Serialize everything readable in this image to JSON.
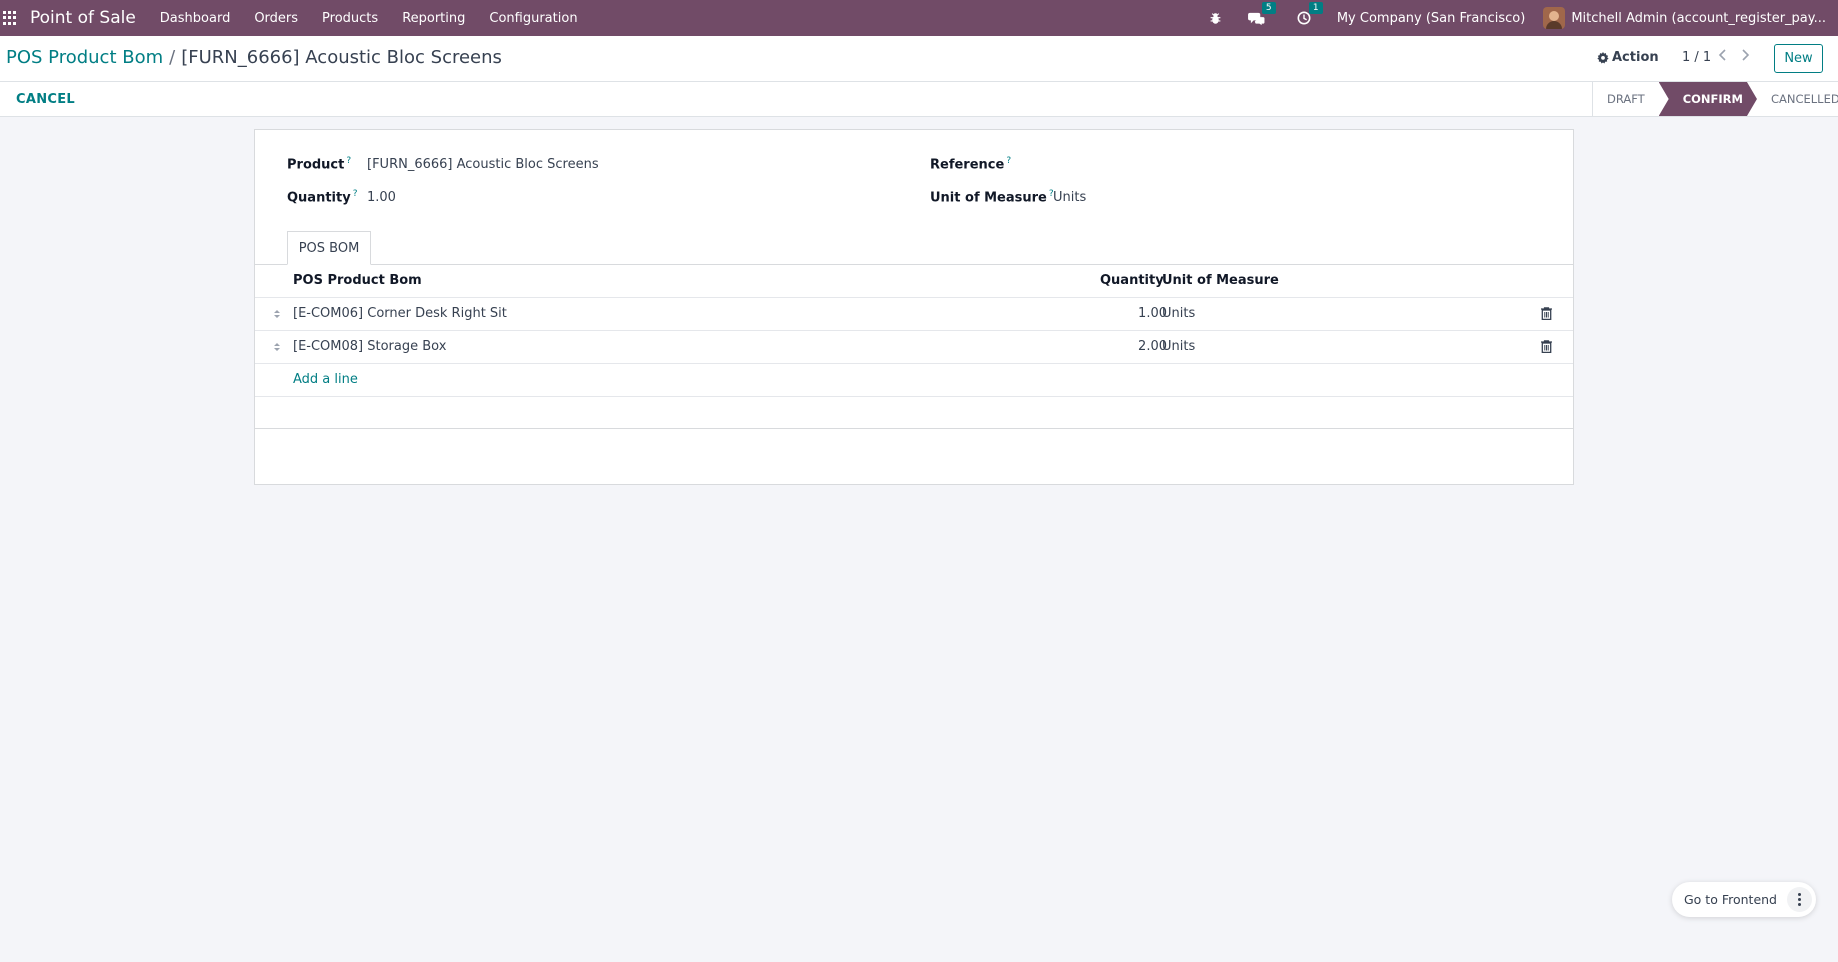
{
  "navbar": {
    "app_title": "Point of Sale",
    "menu": [
      "Dashboard",
      "Orders",
      "Products",
      "Reporting",
      "Configuration"
    ],
    "messages_count": "5",
    "activities_count": "1",
    "company": "My Company (San Francisco)",
    "user": "Mitchell Admin (account_register_pay..."
  },
  "breadcrumb": {
    "parent": "POS Product Bom",
    "separator": "/",
    "current": "[FURN_6666] Acoustic Bloc Screens"
  },
  "controls": {
    "action_label": "Action",
    "pager": "1 / 1",
    "new_label": "New"
  },
  "statusbar": {
    "cancel_label": "CANCEL",
    "states": [
      "DRAFT",
      "CONFIRM",
      "CANCELLED"
    ],
    "active_state": "CONFIRM"
  },
  "form": {
    "product_label": "Product",
    "product_value": "[FURN_6666] Acoustic Bloc Screens",
    "quantity_label": "Quantity",
    "quantity_value": "1.00",
    "reference_label": "Reference",
    "reference_value": "",
    "uom_label": "Unit of Measure",
    "uom_value": "Units",
    "help_mark": "?"
  },
  "tab": {
    "label": "POS BOM"
  },
  "table": {
    "columns": [
      "POS Product Bom",
      "Quantity",
      "Unit of Measure"
    ],
    "rows": [
      {
        "product": "[E-COM06] Corner Desk Right Sit",
        "quantity": "1.00",
        "uom": "Units"
      },
      {
        "product": "[E-COM08] Storage Box",
        "quantity": "2.00",
        "uom": "Units"
      }
    ],
    "add_line_label": "Add a line"
  },
  "floating": {
    "goto_label": "Go to Frontend"
  },
  "colors": {
    "brand": "#714b67",
    "accent": "#017e84"
  }
}
